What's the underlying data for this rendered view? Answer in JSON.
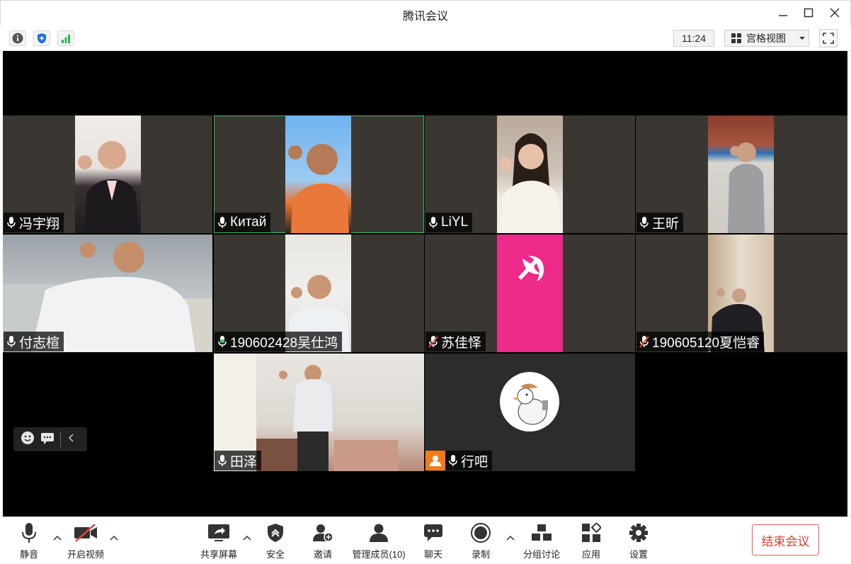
{
  "window": {
    "title": "腾讯会议"
  },
  "infobar": {
    "time": "11:24",
    "layout_label": "宫格视图"
  },
  "participants": [
    {
      "name": "冯宇翔",
      "mic": "on"
    },
    {
      "name": "Китай",
      "mic": "on",
      "active": true
    },
    {
      "name": "LiYL",
      "mic": "on"
    },
    {
      "name": "王昕",
      "mic": "on"
    },
    {
      "name": "付志楦",
      "mic": "on"
    },
    {
      "name": "190602428吴仕鸿",
      "mic": "speaking"
    },
    {
      "name": "苏佳怿",
      "mic": "muted"
    },
    {
      "name": "190605120夏恺睿",
      "mic": "muted"
    },
    {
      "name": "田泽",
      "mic": "on"
    },
    {
      "name": "行吧",
      "mic": "on",
      "host_badge": true
    }
  ],
  "toolbar": {
    "mute": "静音",
    "video": "开启视频",
    "share": "共享屏幕",
    "security": "安全",
    "invite": "邀请",
    "members": "管理成员(10)",
    "chat": "聊天",
    "record": "录制",
    "breakout": "分组讨论",
    "apps": "应用",
    "settings": "设置",
    "end": "结束会议"
  },
  "colors": {
    "end_red": "#e23b33",
    "active_border": "#35c56a",
    "tile_bg": "#3a3733",
    "flag_pink": "#ee2a8a"
  }
}
